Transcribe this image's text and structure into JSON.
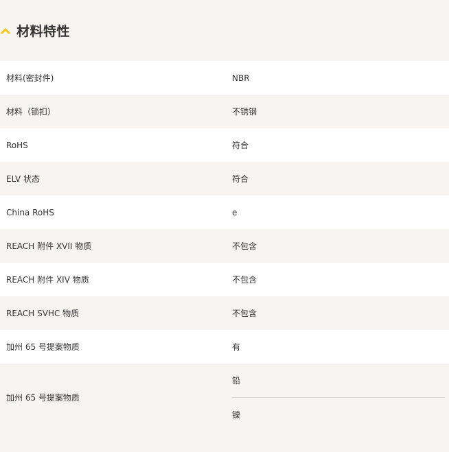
{
  "section": {
    "title": "材料特性",
    "accent_color": "#f5c518",
    "icon": "chevron-up-icon"
  },
  "rows": [
    {
      "label": "材料(密封件)",
      "value": "NBR"
    },
    {
      "label": "材料（锁扣）",
      "value": "不锈钢"
    },
    {
      "label": "RoHS",
      "value": "符合"
    },
    {
      "label": "ELV 状态",
      "value": "符合"
    },
    {
      "label": "China RoHS",
      "value": "e"
    },
    {
      "label": "REACH 附件 XVII 物质",
      "value": "不包含"
    },
    {
      "label": "REACH 附件 XIV 物质",
      "value": "不包含"
    },
    {
      "label": "REACH SVHC 物质",
      "value": "不包含"
    },
    {
      "label": "加州 65 号提案物质",
      "value": "有"
    },
    {
      "label": "加州 65 号提案物质",
      "values": [
        "铅",
        "镍"
      ]
    }
  ]
}
